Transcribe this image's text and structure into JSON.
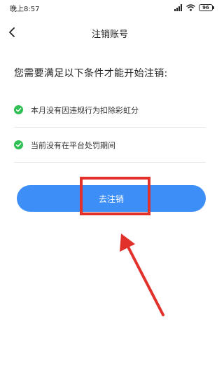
{
  "status_bar": {
    "time": "晚上8:57",
    "battery": "96"
  },
  "header": {
    "title": "注销账号"
  },
  "requirements": {
    "heading": "您需要满足以下条件才能开始注销:",
    "conditions": [
      {
        "text": "本月没有因违规行为扣除彩虹分",
        "met": true
      },
      {
        "text": "当前没有在平台处罚期间",
        "met": true
      }
    ]
  },
  "action": {
    "button_label": "去注销"
  },
  "colors": {
    "primary": "#3d8ef7",
    "check": "#2fbf55",
    "annotation": "#e2312b"
  },
  "icons": [
    "back-icon",
    "check-icon",
    "signal-icon",
    "wifi-icon",
    "battery-icon"
  ]
}
